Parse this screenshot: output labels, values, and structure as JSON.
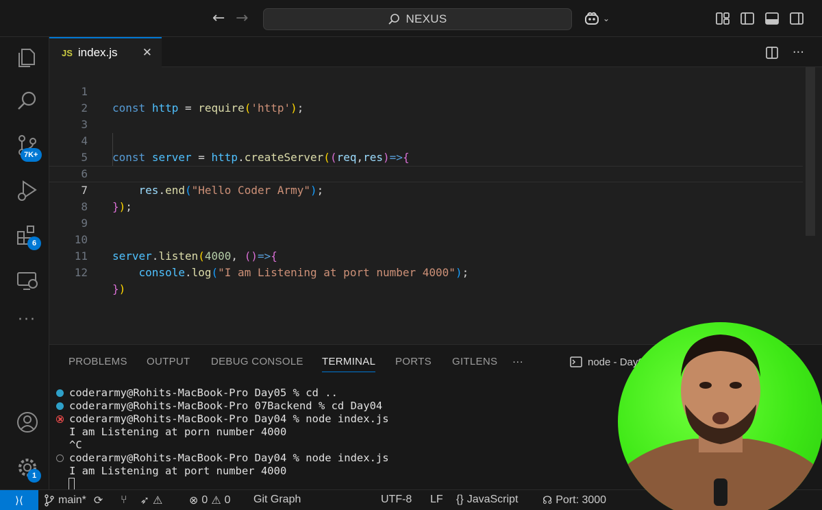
{
  "titlebar": {
    "search_label": "NEXUS",
    "icons": [
      "arrow-left-icon",
      "arrow-right-icon",
      "search-icon",
      "copilot-icon",
      "chevron-down-icon",
      "customize-layout-icon",
      "toggle-primary-sidebar-icon",
      "toggle-panel-icon",
      "toggle-secondary-sidebar-icon"
    ]
  },
  "activitybar": {
    "items": [
      "explorer",
      "search",
      "source-control",
      "run-and-debug",
      "extensions",
      "remote-explorer",
      "more"
    ],
    "source_control_badge": "7K+",
    "extensions_badge": "6",
    "settings_badge": "1"
  },
  "tab": {
    "icon_text": "JS",
    "filename": "index.js",
    "close_glyph": "✕"
  },
  "editor": {
    "active_line": 7,
    "line_numbers": [
      "1",
      "2",
      "3",
      "4",
      "5",
      "6",
      "7",
      "8",
      "9",
      "10",
      "11",
      "12"
    ]
  },
  "panel": {
    "tabs": [
      "PROBLEMS",
      "OUTPUT",
      "DEBUG CONSOLE",
      "TERMINAL",
      "PORTS",
      "GITLENS",
      "···"
    ],
    "active_tab": "TERMINAL",
    "terminal_title": "node - Day0",
    "terminal_lines": [
      {
        "marker": "blue",
        "text": "coderarmy@Rohits-MacBook-Pro Day05 % cd .."
      },
      {
        "marker": "blue",
        "text": "coderarmy@Rohits-MacBook-Pro 07Backend % cd Day04"
      },
      {
        "marker": "error",
        "text": "coderarmy@Rohits-MacBook-Pro Day04 % node index.js"
      },
      {
        "marker": "none",
        "text": "I am Listening at porn number 4000"
      },
      {
        "marker": "none",
        "text": "^C"
      },
      {
        "marker": "empty",
        "text": "coderarmy@Rohits-MacBook-Pro Day04 % node index.js"
      },
      {
        "marker": "none",
        "text": "I am Listening at port number 4000"
      }
    ]
  },
  "statusbar": {
    "branch": "main*",
    "errors": "0",
    "warnings": "0",
    "git_graph": "Git Graph",
    "encoding": "UTF-8",
    "eol": "LF",
    "language": "JavaScript",
    "port": "Port: 3000"
  },
  "colors": {
    "accent": "#0078d4",
    "editor_bg": "#1f1f1f",
    "chrome_bg": "#181818",
    "webcam_green": "#3ee816"
  }
}
